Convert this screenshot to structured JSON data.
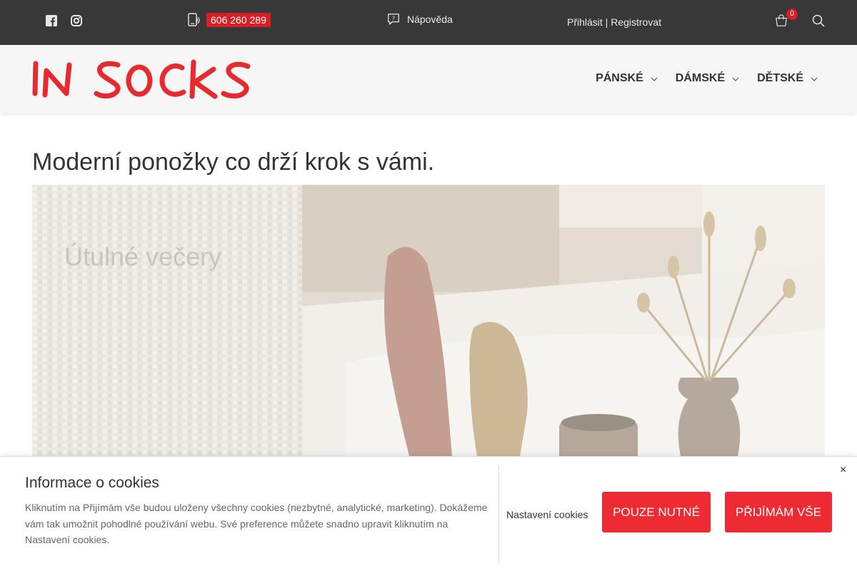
{
  "topbar": {
    "social": [
      {
        "name": "facebook-icon"
      },
      {
        "name": "instagram-icon"
      }
    ],
    "phone_icon": "phone-icon",
    "phone": "606 260 289",
    "help_icon": "help-icon",
    "help": "Nápověda",
    "login": "Přihlásit | Registrovat",
    "cart_icon": "cart-icon",
    "cart_count": "0",
    "search_icon": "search-icon"
  },
  "header": {
    "logo": "IN SOCKS",
    "nav": [
      {
        "label": "PÁNSKÉ"
      },
      {
        "label": "DÁMSKÉ"
      },
      {
        "label": "DĚTSKÉ"
      }
    ]
  },
  "main": {
    "title": "Moderní ponožky co drží krok s vámi.",
    "hero": {
      "caption": "Útulné večery"
    }
  },
  "cookie": {
    "title": "Informace o cookies",
    "text": "Kliknutím na Přijímám vše budou uloženy všechny cookies (nezbytné, analytické, marketing). Dokážeme vám tak umožnit pohodlné používání webu. Své preference můžete snadno upravit kliknutím na Nastavení cookies.",
    "settings": "Nastavení cookies",
    "necessary": "POUZE NUTNÉ",
    "accept_all": "PŘIJÍMÁM VŠE",
    "close": "×"
  },
  "colors": {
    "accent": "#ee2b33",
    "topbar": "#383838"
  }
}
